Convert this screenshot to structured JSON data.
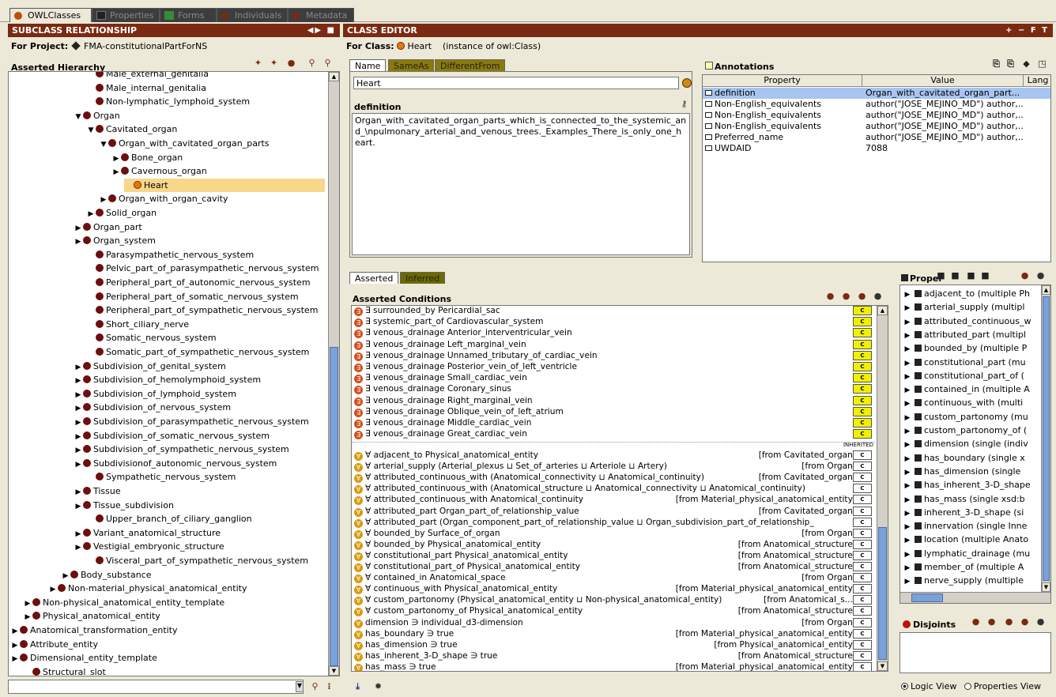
{
  "tabs": [
    {
      "label": "OWLClasses",
      "active": true
    },
    {
      "label": "Properties",
      "active": false
    },
    {
      "label": "Forms",
      "active": false
    },
    {
      "label": "Individuals",
      "active": false
    },
    {
      "label": "Metadata",
      "active": false
    }
  ],
  "left": {
    "header": "SUBCLASS RELATIONSHIP",
    "project_label": "For Project:",
    "project_name": "FMA-constitutionalPartForNS",
    "hierarchy_label": "Asserted Hierarchy",
    "tree": [
      {
        "label": "Male_external_genitalia",
        "indent": 6,
        "exp": "",
        "sel": false
      },
      {
        "label": "Male_internal_genitalia",
        "indent": 6,
        "exp": "",
        "sel": false
      },
      {
        "label": "Non-lymphatic_lymphoid_system",
        "indent": 6,
        "exp": "",
        "sel": false
      },
      {
        "label": "Organ",
        "indent": 5,
        "exp": "▼",
        "sel": false
      },
      {
        "label": "Cavitated_organ",
        "indent": 6,
        "exp": "▼",
        "sel": false
      },
      {
        "label": "Organ_with_cavitated_organ_parts",
        "indent": 7,
        "exp": "▼",
        "sel": false
      },
      {
        "label": "Bone_organ",
        "indent": 8,
        "exp": "▶",
        "sel": false
      },
      {
        "label": "Cavernous_organ",
        "indent": 8,
        "exp": "▶",
        "sel": false
      },
      {
        "label": "Heart",
        "indent": 9,
        "exp": "",
        "sel": true
      },
      {
        "label": "Organ_with_organ_cavity",
        "indent": 7,
        "exp": "▶",
        "sel": false
      },
      {
        "label": "Solid_organ",
        "indent": 6,
        "exp": "▶",
        "sel": false
      },
      {
        "label": "Organ_part",
        "indent": 5,
        "exp": "▶",
        "sel": false
      },
      {
        "label": "Organ_system",
        "indent": 5,
        "exp": "▶",
        "sel": false
      },
      {
        "label": "Parasympathetic_nervous_system",
        "indent": 6,
        "exp": "",
        "sel": false
      },
      {
        "label": "Pelvic_part_of_parasympathetic_nervous_system",
        "indent": 6,
        "exp": "",
        "sel": false
      },
      {
        "label": "Peripheral_part_of_autonomic_nervous_system",
        "indent": 6,
        "exp": "",
        "sel": false
      },
      {
        "label": "Peripheral_part_of_somatic_nervous_system",
        "indent": 6,
        "exp": "",
        "sel": false
      },
      {
        "label": "Peripheral_part_of_sympathetic_nervous_system",
        "indent": 6,
        "exp": "",
        "sel": false
      },
      {
        "label": "Short_ciliary_nerve",
        "indent": 6,
        "exp": "",
        "sel": false
      },
      {
        "label": "Somatic_nervous_system",
        "indent": 6,
        "exp": "",
        "sel": false
      },
      {
        "label": "Somatic_part_of_sympathetic_nervous_system",
        "indent": 6,
        "exp": "",
        "sel": false
      },
      {
        "label": "Subdivision_of_genital_system",
        "indent": 5,
        "exp": "▶",
        "sel": false
      },
      {
        "label": "Subdivision_of_hemolymphoid_system",
        "indent": 5,
        "exp": "▶",
        "sel": false
      },
      {
        "label": "Subdivision_of_lymphoid_system",
        "indent": 5,
        "exp": "▶",
        "sel": false
      },
      {
        "label": "Subdivision_of_nervous_system",
        "indent": 5,
        "exp": "▶",
        "sel": false
      },
      {
        "label": "Subdivision_of_parasympathetic_nervous_system",
        "indent": 5,
        "exp": "▶",
        "sel": false
      },
      {
        "label": "Subdivision_of_somatic_nervous_system",
        "indent": 5,
        "exp": "▶",
        "sel": false
      },
      {
        "label": "Subdivision_of_sympathetic_nervous_system",
        "indent": 5,
        "exp": "▶",
        "sel": false
      },
      {
        "label": "Subdivisionof_autonomic_nervous_system",
        "indent": 5,
        "exp": "▶",
        "sel": false
      },
      {
        "label": "Sympathetic_nervous_system",
        "indent": 6,
        "exp": "",
        "sel": false
      },
      {
        "label": "Tissue",
        "indent": 5,
        "exp": "▶",
        "sel": false
      },
      {
        "label": "Tissue_subdivision",
        "indent": 5,
        "exp": "▶",
        "sel": false
      },
      {
        "label": "Upper_branch_of_ciliary_ganglion",
        "indent": 6,
        "exp": "",
        "sel": false
      },
      {
        "label": "Variant_anatomical_structure",
        "indent": 5,
        "exp": "▶",
        "sel": false
      },
      {
        "label": "Vestigial_embryonic_structure",
        "indent": 5,
        "exp": "▶",
        "sel": false
      },
      {
        "label": "Visceral_part_of_sympathetic_nervous_system",
        "indent": 6,
        "exp": "",
        "sel": false
      },
      {
        "label": "Body_substance",
        "indent": 4,
        "exp": "▶",
        "sel": false
      },
      {
        "label": "Non-material_physical_anatomical_entity",
        "indent": 3,
        "exp": "▶",
        "sel": false
      },
      {
        "label": "Non-physical_anatomical_entity_template",
        "indent": 1,
        "exp": "▶",
        "sel": false
      },
      {
        "label": "Physical_anatomical_entity",
        "indent": 1,
        "exp": "▶",
        "sel": false
      },
      {
        "label": "Anatomical_transformation_entity",
        "indent": 0,
        "exp": "▶",
        "sel": false
      },
      {
        "label": "Attribute_entity",
        "indent": 0,
        "exp": "▶",
        "sel": false
      },
      {
        "label": "Dimensional_entity_template",
        "indent": 0,
        "exp": "▶",
        "sel": false
      },
      {
        "label": "Structural_slot",
        "indent": 1,
        "exp": "",
        "sel": false
      }
    ]
  },
  "editor": {
    "header": "CLASS EDITOR",
    "header_controls": "+ − F T",
    "for_class_label": "For Class:",
    "class_name": "Heart",
    "class_instance": "(instance of owl:Class)",
    "tabs": [
      "Name",
      "SameAs",
      "DifferentFrom"
    ],
    "name_value": "Heart",
    "definition_label": "definition",
    "definition_text": "Organ_with_cavitated_organ_parts_which_is_connected_to_the_systemic_and_\\npulmonary_arterial_and_venous_trees._Examples_There_is_only_one_heart."
  },
  "annotations": {
    "title": "Annotations",
    "col_property": "Property",
    "col_value": "Value",
    "col_lang": "Lang",
    "rows": [
      {
        "property": "definition",
        "value": "Organ_with_cavitated_organ_part...",
        "sel": true
      },
      {
        "property": "Non-English_equivalents",
        "value": "author(\"JOSE_MEJINO_MD\") author,..",
        "sel": false
      },
      {
        "property": "Non-English_equivalents",
        "value": "author(\"JOSE_MEJINO_MD\") author,..",
        "sel": false
      },
      {
        "property": "Non-English_equivalents",
        "value": "author(\"JOSE_MEJINO_MD\") author,..",
        "sel": false
      },
      {
        "property": "Preferred_name",
        "value": "author(\"JOSE_MEJINO_MD\") author,..",
        "sel": false
      },
      {
        "property": "UWDAID",
        "value": "7088",
        "sel": false
      }
    ]
  },
  "conditions": {
    "tabs": [
      "Asserted",
      "Inferred"
    ],
    "title": "Asserted Conditions",
    "inherited_label": "INHERITED",
    "asserted": [
      "∃ surrounded_by Pericardial_sac",
      "∃ systemic_part_of Cardiovascular_system",
      "∃ venous_drainage Anterior_interventricular_vein",
      "∃ venous_drainage Left_marginal_vein",
      "∃ venous_drainage Unnamed_tributary_of_cardiac_vein",
      "∃ venous_drainage Posterior_vein_of_left_ventricle",
      "∃ venous_drainage Small_cardiac_vein",
      "∃ venous_drainage Coronary_sinus",
      "∃ venous_drainage Right_marginal_vein",
      "∃ venous_drainage Oblique_vein_of_left_atrium",
      "∃ venous_drainage Middle_cardiac_vein",
      "∃ venous_drainage Great_cardiac_vein"
    ],
    "inherited": [
      {
        "text": "∀ adjacent_to Physical_anatomical_entity",
        "from": "[from Cavitated_organ]"
      },
      {
        "text": "∀ arterial_supply (Arterial_plexus ⊔ Set_of_arteries ⊔ Arteriole ⊔ Artery)",
        "from": "[from Organ]"
      },
      {
        "text": "∀ attributed_continuous_with (Anatomical_connectivity ⊔ Anatomical_continuity)",
        "from": "[from Cavitated_organ]"
      },
      {
        "text": "∀ attributed_continuous_with (Anatomical_structure ⊔ Anatomical_connectivity ⊔ Anatomical_continuity)",
        "from": ""
      },
      {
        "text": "∀ attributed_continuous_with Anatomical_continuity",
        "from": "[from Material_physical_anatomical_entity]"
      },
      {
        "text": "∀ attributed_part Organ_part_of_relationship_value",
        "from": "[from Cavitated_organ]"
      },
      {
        "text": "∀ attributed_part (Organ_component_part_of_relationship_value ⊔ Organ_subdivision_part_of_relationship_",
        "from": ""
      },
      {
        "text": "∀ bounded_by Surface_of_organ",
        "from": "[from Organ]"
      },
      {
        "text": "∀ bounded_by Physical_anatomical_entity",
        "from": "[from Anatomical_structure]"
      },
      {
        "text": "∀ constitutional_part Physical_anatomical_entity",
        "from": "[from Anatomical_structure]"
      },
      {
        "text": "∀ constitutional_part_of Physical_anatomical_entity",
        "from": "[from Anatomical_structure]"
      },
      {
        "text": "∀ contained_in Anatomical_space",
        "from": "[from Organ]"
      },
      {
        "text": "∀ continuous_with Physical_anatomical_entity",
        "from": "[from Material_physical_anatomical_entity]"
      },
      {
        "text": "∀ custom_partonomy (Physical_anatomical_entity ⊔ Non-physical_anatomical_entity)",
        "from": "[from Anatomical_s...]"
      },
      {
        "text": "∀ custom_partonomy_of Physical_anatomical_entity",
        "from": "[from Anatomical_structure]"
      },
      {
        "text": "dimension ∋ individual_d3-dimension",
        "from": "[from Organ]"
      },
      {
        "text": "has_boundary ∋ true",
        "from": "[from Material_physical_anatomical_entity]"
      },
      {
        "text": "has_dimension ∋ true",
        "from": "[from Physical_anatomical_entity]"
      },
      {
        "text": "has_inherent_3-D_shape ∋ true",
        "from": "[from Anatomical_structure]"
      },
      {
        "text": "has_mass ∋ true",
        "from": "[from Material_physical_anatomical_entity]"
      }
    ]
  },
  "properties": {
    "title": "Proper",
    "items": [
      "adjacent_to  (multiple Ph",
      "arterial_supply  (multipl",
      "attributed_continuous_w",
      "attributed_part  (multipl",
      "bounded_by  (multiple P",
      "constitutional_part  (mu",
      "constitutional_part_of  (",
      "contained_in  (multiple A",
      "continuous_with  (multi",
      "custom_partonomy  (mu",
      "custom_partonomy_of  (",
      "dimension  (single (indiv",
      "has_boundary  (single x",
      "has_dimension  (single",
      "has_inherent_3-D_shape",
      "has_mass  (single xsd:b",
      "inherent_3-D_shape  (si",
      "innervation  (single Inne",
      "location  (multiple Anato",
      "lymphatic_drainage  (mu",
      "member_of  (multiple A",
      "nerve_supply  (multiple"
    ]
  },
  "disjoints": {
    "title": "Disjoints"
  },
  "view": {
    "logic": "Logic View",
    "properties": "Properties View"
  }
}
